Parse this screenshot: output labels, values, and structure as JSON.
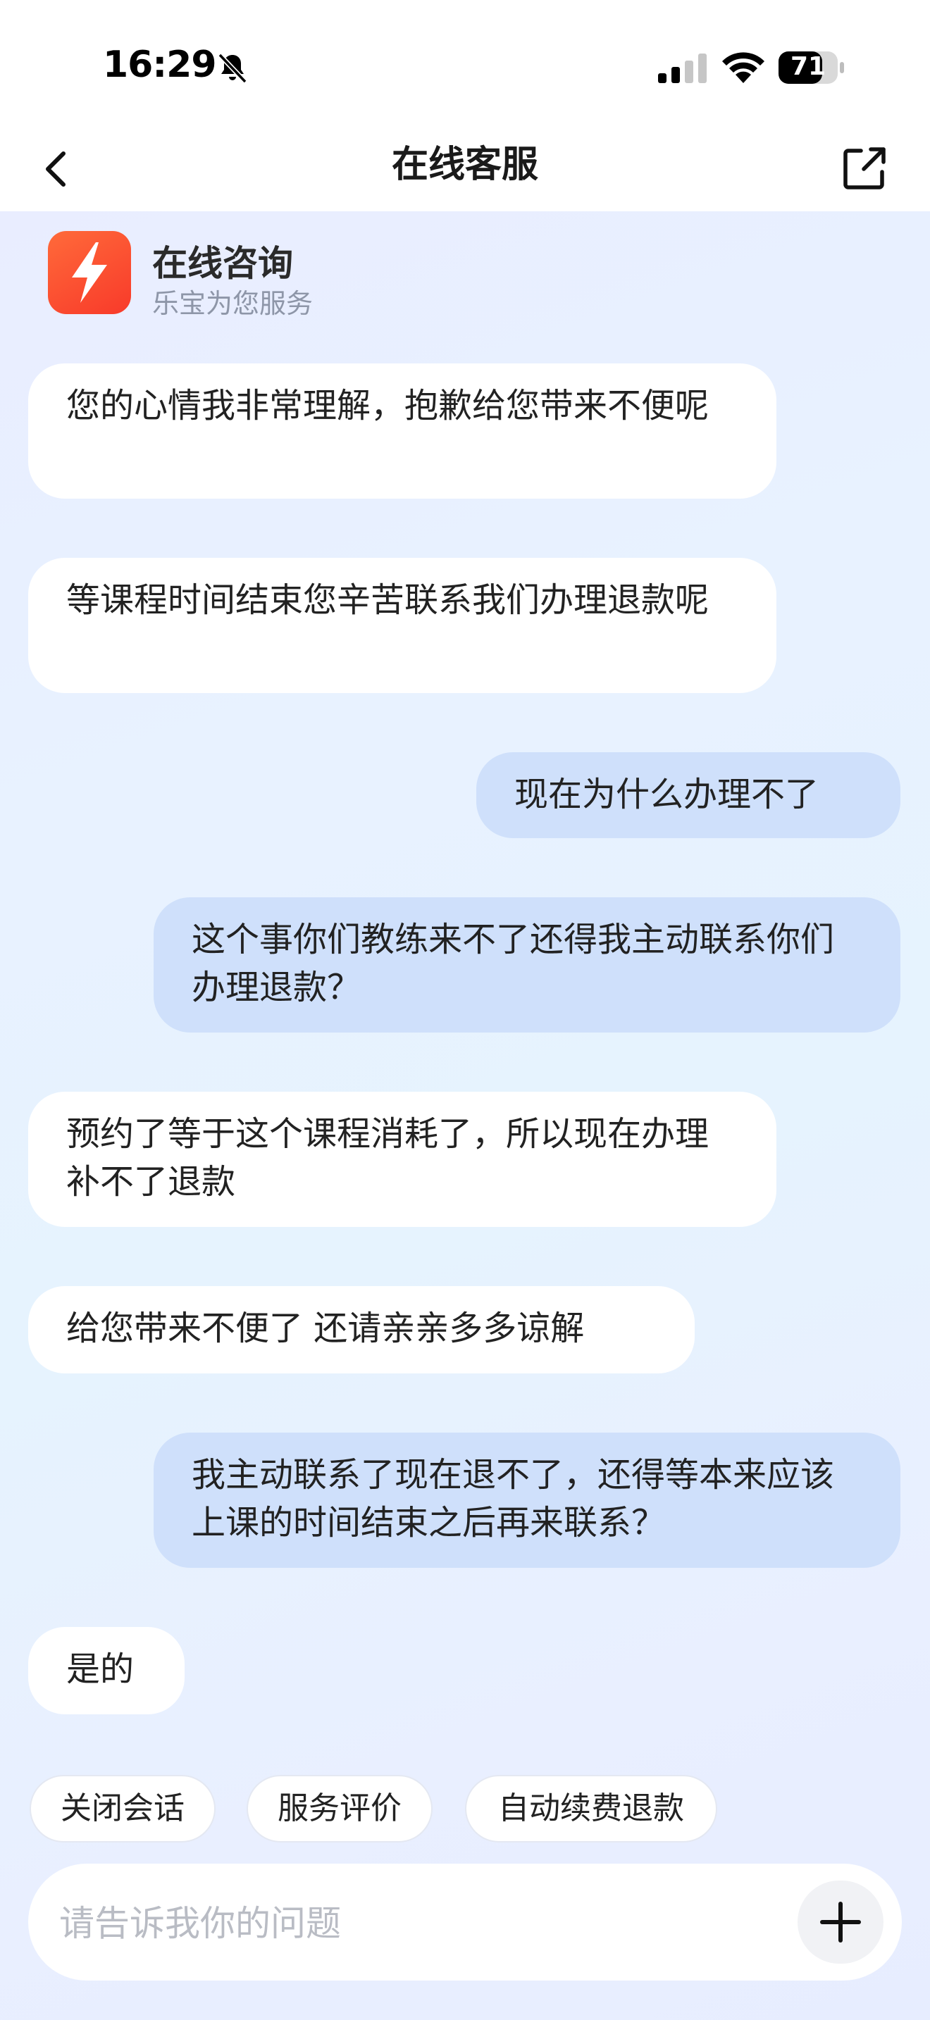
{
  "status_bar": {
    "time": "16:29",
    "battery": "71"
  },
  "nav": {
    "title": "在线客服"
  },
  "agent": {
    "name": "在线咨询",
    "subtitle": "乐宝为您服务",
    "logo_color": "#f8452e"
  },
  "messages": [
    {
      "side": "left",
      "text": "您的心情我非常理解，抱歉给您带来不便呢"
    },
    {
      "side": "left",
      "text": "等课程时间结束您辛苦联系我们办理退款呢"
    },
    {
      "side": "right",
      "text": "现在为什么办理不了"
    },
    {
      "side": "right",
      "text": "这个事你们教练来不了还得我主动联系你们办理退款？"
    },
    {
      "side": "left",
      "text": "预约了等于这个课程消耗了，所以现在办理补不了退款"
    },
    {
      "side": "left",
      "text": "给您带来不便了 还请亲亲多多谅解"
    },
    {
      "side": "right",
      "text": "我主动联系了现在退不了，还得等本来应该上课的时间结束之后再来联系？"
    },
    {
      "side": "left",
      "text": "是的"
    }
  ],
  "quick_replies": [
    "关闭会话",
    "服务评价",
    "自动续费退款"
  ],
  "input": {
    "placeholder": "请告诉我你的问题"
  },
  "colors": {
    "user_bubble": "#cfe0fb",
    "agent_bubble": "#ffffff",
    "chat_background": "#e8f1ff"
  }
}
